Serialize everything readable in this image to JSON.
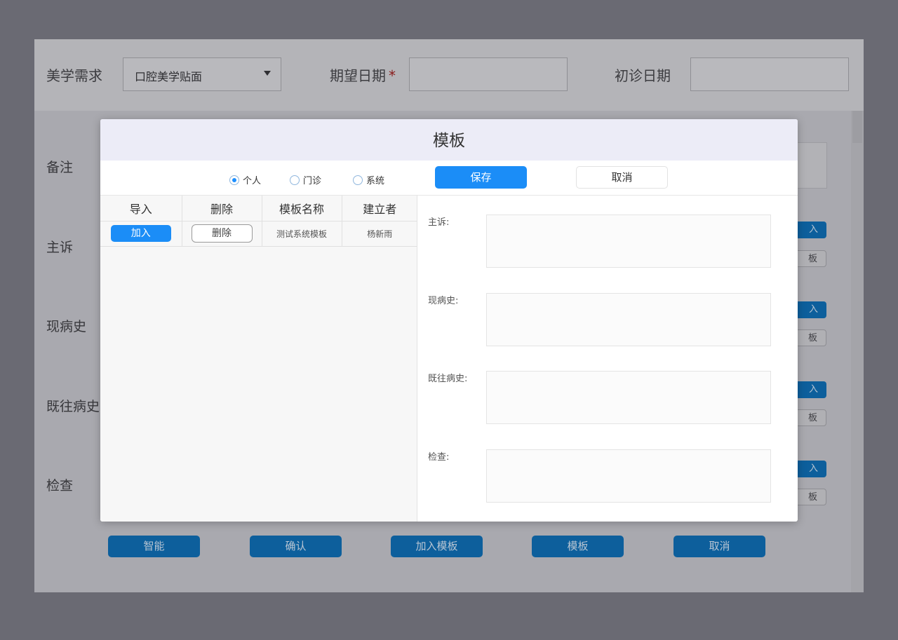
{
  "background": {
    "aesthetic_label": "美学需求",
    "aesthetic_select_value": "口腔美学贴面",
    "expected_date_label": "期望日期",
    "required_mark": "*",
    "first_visit_label": "初诊日期",
    "rows": [
      {
        "label": "备注"
      },
      {
        "label": "主诉",
        "add_label": "入",
        "template_label": "板"
      },
      {
        "label": "现病史",
        "add_label": "入",
        "template_label": "板"
      },
      {
        "label": "既往病史",
        "add_label": "入",
        "template_label": "板"
      },
      {
        "label": "检查",
        "add_label": "入",
        "template_label": "板"
      }
    ],
    "footer_buttons": [
      "智能",
      "确认",
      "加入模板",
      "模板",
      "取消"
    ]
  },
  "modal": {
    "title": "模板",
    "radios": [
      {
        "label": "个人",
        "checked": true
      },
      {
        "label": "门诊",
        "checked": false
      },
      {
        "label": "系统",
        "checked": false
      }
    ],
    "save_label": "保存",
    "cancel_label": "取消",
    "table": {
      "headers": [
        "导入",
        "删除",
        "模板名称",
        "建立者"
      ],
      "rows": [
        {
          "import_label": "加入",
          "delete_label": "删除",
          "name": "测试系统模板",
          "creator": "杨新雨"
        }
      ]
    },
    "fields": [
      {
        "label": "主诉:",
        "value": ""
      },
      {
        "label": "现病史:",
        "value": ""
      },
      {
        "label": "既往病史:",
        "value": ""
      },
      {
        "label": "检查:",
        "value": ""
      }
    ]
  },
  "colors": {
    "primary": "#1b8df7",
    "header_bg": "#ececf7",
    "overlay": "#6a6a73"
  }
}
